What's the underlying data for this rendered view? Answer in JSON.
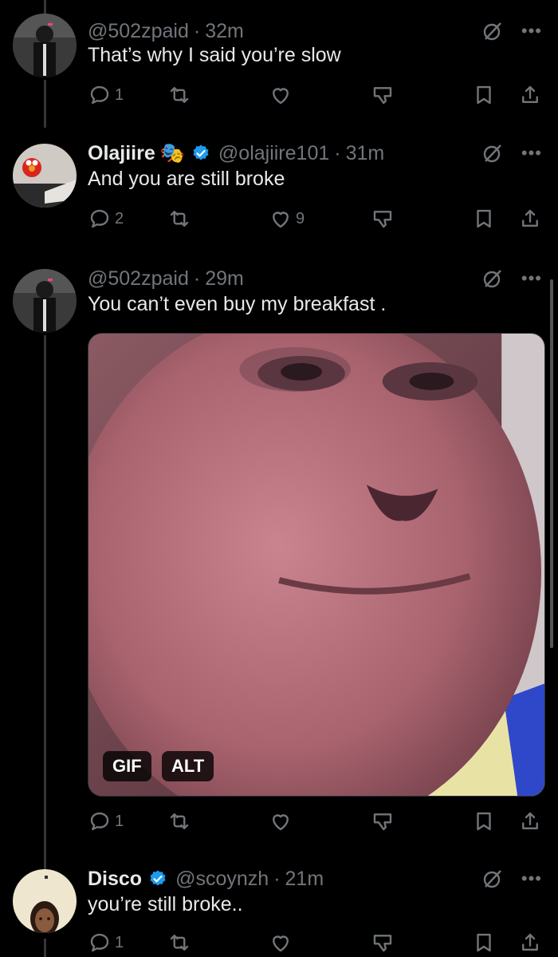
{
  "tweets": [
    {
      "handle": "@502zpaid",
      "separator": "·",
      "time": "32m",
      "text": "That’s why I said you’re slow",
      "replies": "1",
      "retweets": "",
      "likes": "",
      "avatar": "dark-figure-avatar"
    },
    {
      "display_name": "Olajiire",
      "badge_emoji": "🎭",
      "handle": "@olajiire101",
      "separator": "·",
      "time": "31m",
      "text": "And you are still broke",
      "replies": "2",
      "retweets": "",
      "likes": "9",
      "verified": true,
      "avatar": "elmo-avatar"
    },
    {
      "handle": "@502zpaid",
      "separator": "·",
      "time": "29m",
      "text": "You can’t even buy my breakfast .",
      "replies": "1",
      "retweets": "",
      "likes": "",
      "media": {
        "type": "gif",
        "gif_label": "GIF",
        "alt_label": "ALT",
        "subject": "monkey-face"
      }
    },
    {
      "display_name": "Disco",
      "handle": "@scoynzh",
      "separator": "·",
      "time": "21m",
      "text": "you’re still broke..",
      "replies": "1",
      "retweets": "",
      "likes": "",
      "verified": true,
      "avatar": "person-avatar"
    }
  ],
  "colors": {
    "background": "#000000",
    "text_primary": "#e7e9ea",
    "text_secondary": "#71767b",
    "verified_blue": "#1d9bf0",
    "thread_line": "#333639"
  },
  "icons": [
    "reply-icon",
    "retweet-icon",
    "like-icon",
    "dislike-icon",
    "bookmark-icon",
    "share-icon",
    "grok-icon",
    "more-icon",
    "verified-icon"
  ]
}
